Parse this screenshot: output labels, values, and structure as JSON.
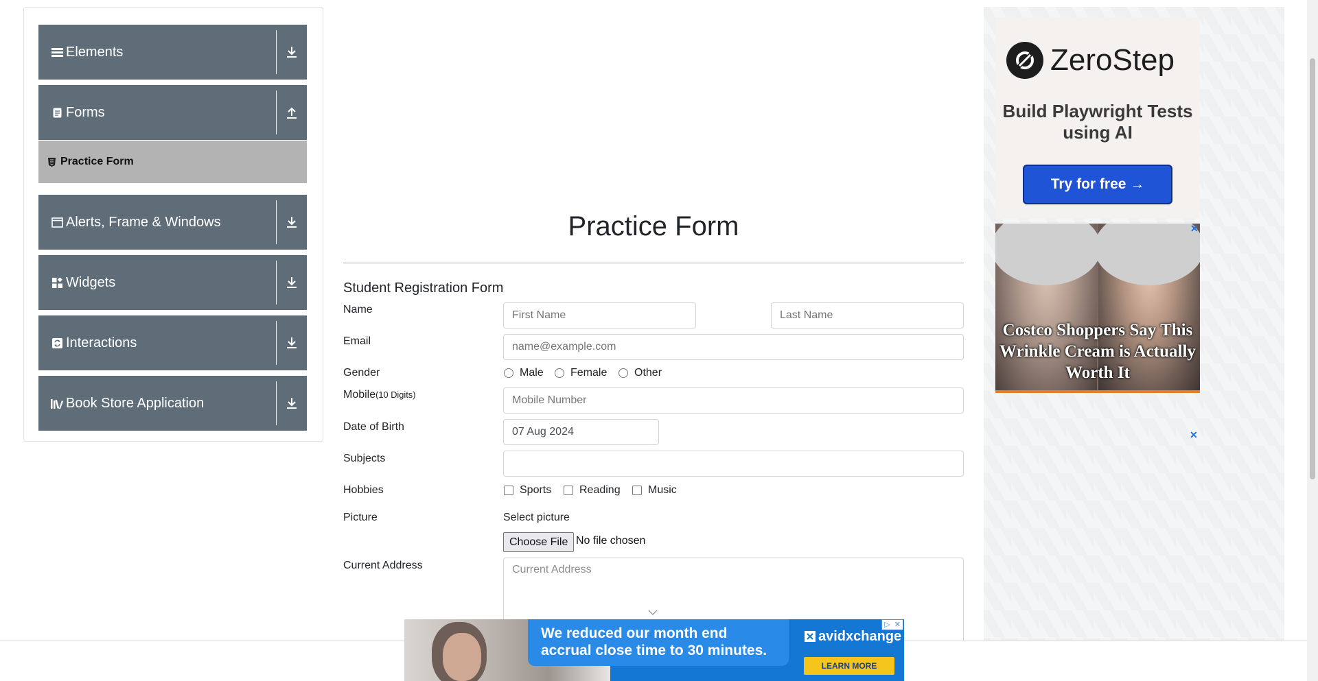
{
  "sidebar": {
    "groups": [
      {
        "label": "Elements",
        "icon": "menu-icon",
        "arrow": "download-arrow-icon"
      },
      {
        "label": "Forms",
        "icon": "document-icon",
        "arrow": "upload-arrow-icon"
      },
      {
        "label": "Alerts, Frame & Windows",
        "icon": "window-icon",
        "arrow": "download-arrow-icon"
      },
      {
        "label": "Widgets",
        "icon": "widgets-icon",
        "arrow": "download-arrow-icon"
      },
      {
        "label": "Interactions",
        "icon": "refresh-icon",
        "arrow": "download-arrow-icon"
      },
      {
        "label": "Book Store Application",
        "icon": "library-icon",
        "arrow": "download-arrow-icon"
      }
    ],
    "active_item": {
      "label": "Practice Form",
      "icon": "html5-icon"
    }
  },
  "main": {
    "page_title": "Practice Form",
    "form_title": "Student Registration Form",
    "labels": {
      "name": "Name",
      "email": "Email",
      "gender": "Gender",
      "mobile": "Mobile",
      "mobile_hint": "(10 Digits)",
      "dob": "Date of Birth",
      "subjects": "Subjects",
      "hobbies": "Hobbies",
      "picture": "Picture",
      "address": "Current Address"
    },
    "fields": {
      "first_name_placeholder": "First Name",
      "last_name_placeholder": "Last Name",
      "email_placeholder": "name@example.com",
      "mobile_placeholder": "Mobile Number",
      "dob_value": "07 Aug 2024",
      "subjects_value": "",
      "address_placeholder": "Current Address"
    },
    "gender_options": [
      "Male",
      "Female",
      "Other"
    ],
    "hobby_options": [
      "Sports",
      "Reading",
      "Music"
    ],
    "picture": {
      "select_label": "Select picture",
      "button_label": "Choose File",
      "status": "No file chosen"
    }
  },
  "ads": {
    "zerostep": {
      "brand": "ZeroStep",
      "tagline": "Build Playwright Tests using AI",
      "cta": "Try for free →"
    },
    "cream": {
      "headline": "Costco Shoppers Say This Wrinkle Cream is Actually Worth It"
    },
    "close_glyph": "✕",
    "bottom": {
      "text": "We reduced our month end accrual close time to 30 minutes.",
      "brand": "avidxchange",
      "cta": "LEARN MORE"
    }
  },
  "colors": {
    "sidebar_header": "#5f6d78",
    "sidebar_active": "#b3b3b3",
    "zerostep_button": "#1f54d6",
    "bottom_ad_blue": "#1477d3"
  }
}
